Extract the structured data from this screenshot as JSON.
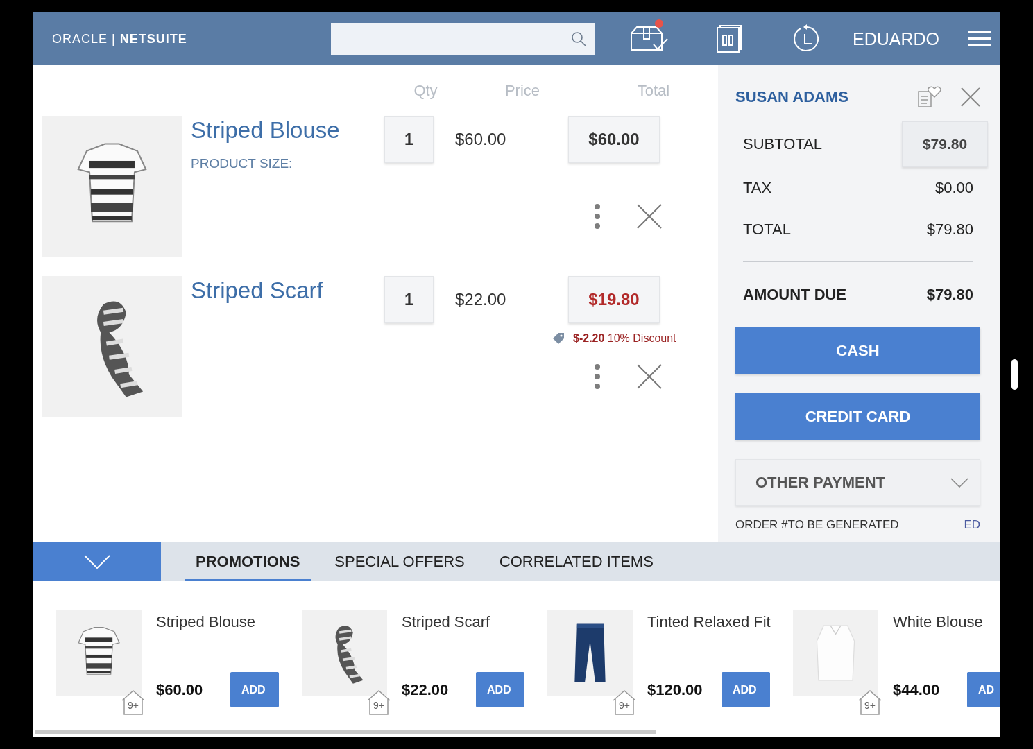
{
  "header": {
    "logo": "ORACLE | **NETSUITE**",
    "orders_alert": true,
    "user": "EDUARDO"
  },
  "cart": {
    "columns": {
      "qty": "Qty",
      "price": "Price",
      "total": "Total"
    },
    "items": [
      {
        "name": "Striped Blouse",
        "size_label": "PRODUCT SIZE:",
        "qty": "1",
        "price": "$60.00",
        "total": "$60.00",
        "discounted": false
      },
      {
        "name": "Striped Scarf",
        "qty": "1",
        "price": "$22.00",
        "total": "$19.80",
        "discounted": true,
        "discount": {
          "amount": "$-2.20",
          "label": "10% Discount"
        }
      }
    ]
  },
  "summary": {
    "customer": "SUSAN ADAMS",
    "subtotal": {
      "label": "SUBTOTAL",
      "value": "$79.80"
    },
    "lines": [
      {
        "label": "TAX",
        "value": "$0.00"
      },
      {
        "label": "TOTAL",
        "value": "$79.80"
      }
    ],
    "amount_due": {
      "label": "AMOUNT DUE",
      "value": "$79.80"
    },
    "payments": [
      "CASH",
      "CREDIT CARD"
    ],
    "other_payment": "OTHER PAYMENT",
    "order": {
      "label": "ORDER #TO BE GENERATED",
      "status": "ED"
    }
  },
  "tabs": [
    {
      "label": "PROMOTIONS",
      "selected": true
    },
    {
      "label": "SPECIAL OFFERS",
      "selected": false
    },
    {
      "label": "CORRELATED ITEMS",
      "selected": false
    }
  ],
  "products": [
    {
      "name": "Striped Blouse",
      "price": "$60.00",
      "button": "ADD",
      "stock": "9+"
    },
    {
      "name": "Striped Scarf",
      "price": "$22.00",
      "button": "ADD",
      "stock": "9+"
    },
    {
      "name": "Tinted Relaxed Fit",
      "price": "$120.00",
      "button": "ADD",
      "stock": "9+"
    },
    {
      "name": "White Blouse",
      "price": "$44.00",
      "button": "AD",
      "stock": "9+"
    }
  ]
}
